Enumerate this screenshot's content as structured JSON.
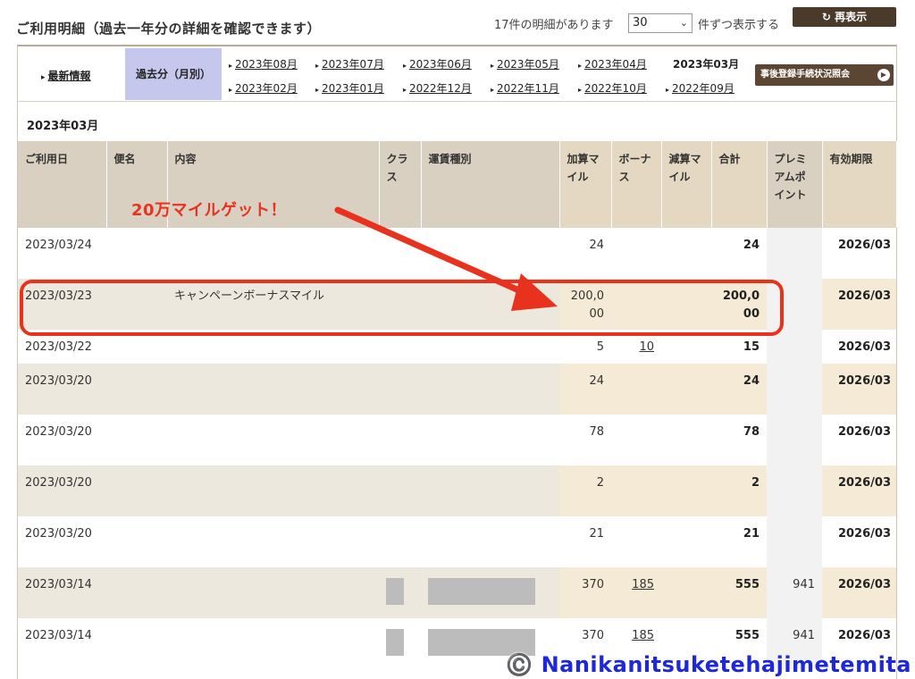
{
  "header": {
    "title": "ご利用明細（過去一年分の詳細を確認できます）",
    "count_text": "17件の明細があります",
    "per_page_value": "30",
    "per_page_label": "件ずつ表示する",
    "refresh_label": "再表示"
  },
  "nav": {
    "latest_label": "最新情報",
    "past_tab_label": "過去分（月別）",
    "months_row1": [
      "2023年08月",
      "2023年07月",
      "2023年06月",
      "2023年05月",
      "2023年04月"
    ],
    "current_month": "2023年03月",
    "months_row2": [
      "2023年02月",
      "2023年01月",
      "2022年12月",
      "2022年11月",
      "2022年10月",
      "2022年09月"
    ],
    "post_registration_label": "事後登録手続状況照会"
  },
  "month_heading": "2023年03月",
  "table": {
    "headers": [
      "ご利用日",
      "便名",
      "内容",
      "クラス",
      "運賃種別",
      "加算マイル",
      "ボーナス",
      "減算マイル",
      "合計",
      "プレミアムポイント",
      "有効期限"
    ],
    "rows": [
      {
        "date": "2023/03/24",
        "flight": "",
        "content": "",
        "added": "24",
        "bonus": "",
        "deducted": "",
        "total": "24",
        "premium": "",
        "expiry": "2026/03"
      },
      {
        "date": "2023/03/23",
        "flight": "",
        "content": "キャンペーンボーナスマイル",
        "added": "200,000",
        "bonus": "",
        "deducted": "",
        "total": "200,000",
        "premium": "",
        "expiry": "2026/03"
      },
      {
        "date": "2023/03/22",
        "flight": "",
        "content": "",
        "added": "5",
        "bonus": "10",
        "deducted": "",
        "total": "15",
        "premium": "",
        "expiry": "2026/03"
      },
      {
        "date": "2023/03/20",
        "flight": "",
        "content": "",
        "added": "24",
        "bonus": "",
        "deducted": "",
        "total": "24",
        "premium": "",
        "expiry": "2026/03"
      },
      {
        "date": "2023/03/20",
        "flight": "",
        "content": "",
        "added": "78",
        "bonus": "",
        "deducted": "",
        "total": "78",
        "premium": "",
        "expiry": "2026/03"
      },
      {
        "date": "2023/03/20",
        "flight": "",
        "content": "",
        "added": "2",
        "bonus": "",
        "deducted": "",
        "total": "2",
        "premium": "",
        "expiry": "2026/03"
      },
      {
        "date": "2023/03/20",
        "flight": "",
        "content": "",
        "added": "21",
        "bonus": "",
        "deducted": "",
        "total": "21",
        "premium": "",
        "expiry": "2026/03"
      },
      {
        "date": "2023/03/14",
        "flight": "",
        "content": "",
        "added": "370",
        "bonus": "185",
        "deducted": "",
        "total": "555",
        "premium": "941",
        "expiry": "2026/03"
      },
      {
        "date": "2023/03/14",
        "flight": "",
        "content": "",
        "added": "370",
        "bonus": "185",
        "deducted": "",
        "total": "555",
        "premium": "941",
        "expiry": "2026/03"
      }
    ]
  },
  "annotation": {
    "text": "20万マイルゲット！",
    "color": "#e8321e"
  },
  "watermark": "©️ Nanikanitsuketehajimetemita",
  "colors": {
    "header_bg": "#d9d0c2",
    "accent_button": "#4a3a2a",
    "past_tab": "#c5c8ec",
    "watermark": "#1d28d8"
  }
}
